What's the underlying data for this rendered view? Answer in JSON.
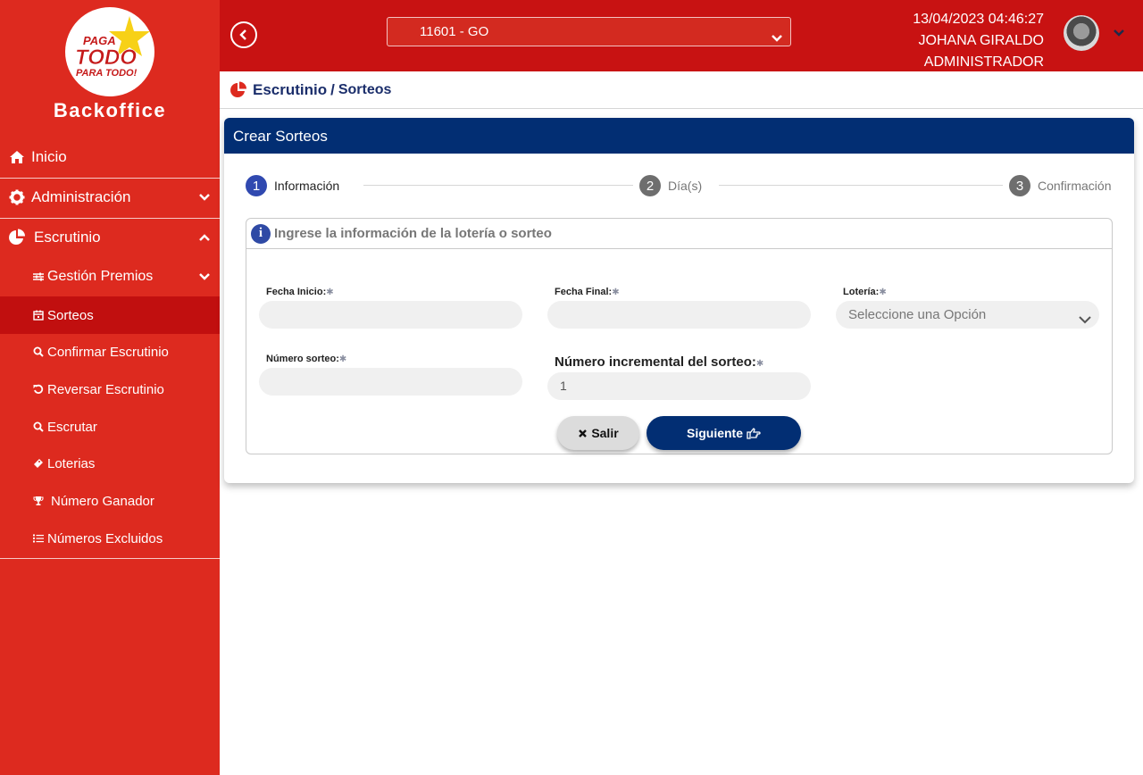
{
  "sidebar": {
    "logo_text": [
      "PAGA",
      "TODO",
      "PARA TODO!"
    ],
    "brand": "Backoffice",
    "items": [
      {
        "label": "Inicio",
        "icon": "home-icon"
      },
      {
        "label": "Administración",
        "icon": "gear-icon"
      },
      {
        "label": "Escrutinio",
        "icon": "pie-chart-icon"
      }
    ],
    "subitems": [
      {
        "label": "Gestión Premios",
        "icon": "sliders-icon"
      },
      {
        "label": "Sorteos",
        "icon": "calendar-icon"
      },
      {
        "label": "Confirmar Escrutinio",
        "icon": "search-check-icon"
      },
      {
        "label": "Reversar Escrutinio",
        "icon": "undo-icon"
      },
      {
        "label": "Escrutar",
        "icon": "search-icon"
      },
      {
        "label": "Loterias",
        "icon": "ticket-icon"
      },
      {
        "label": "Número Ganador",
        "icon": "trophy-icon"
      },
      {
        "label": "Números Excluidos",
        "icon": "list-icon"
      }
    ]
  },
  "topbar": {
    "office_select": "11601 - GO",
    "datetime": "13/04/2023 04:46:27",
    "user_name": "JOHANA GIRALDO",
    "role": "ADMINISTRADOR"
  },
  "breadcrumb": {
    "section": "Escrutinio",
    "separator": "/",
    "page": "Sorteos"
  },
  "card": {
    "title": "Crear Sorteos",
    "steps": [
      {
        "number": "1",
        "label": "Información"
      },
      {
        "number": "2",
        "label": "Día(s)"
      },
      {
        "number": "3",
        "label": "Confirmación"
      }
    ],
    "panel_title": "Ingrese la información de la lotería o sorteo",
    "info_icon": "i",
    "required_mark": "✱",
    "fields": {
      "fecha_inicio": {
        "label": "Fecha Inicio:",
        "value": ""
      },
      "fecha_final": {
        "label": "Fecha Final:",
        "value": ""
      },
      "loteria": {
        "label": "Lotería:",
        "value": "Seleccione una Opción"
      },
      "numero_sorteo": {
        "label": "Número sorteo:",
        "value": ""
      },
      "numero_incremental": {
        "label": "Número incremental del sorteo:",
        "value": "1"
      }
    },
    "buttons": {
      "salir": "Salir",
      "siguiente": "Siguiente"
    }
  },
  "colors": {
    "sidebar": "#dd2a1f",
    "topbar": "#c81212",
    "navy": "#022e73",
    "active_item": "#c10f0f"
  }
}
